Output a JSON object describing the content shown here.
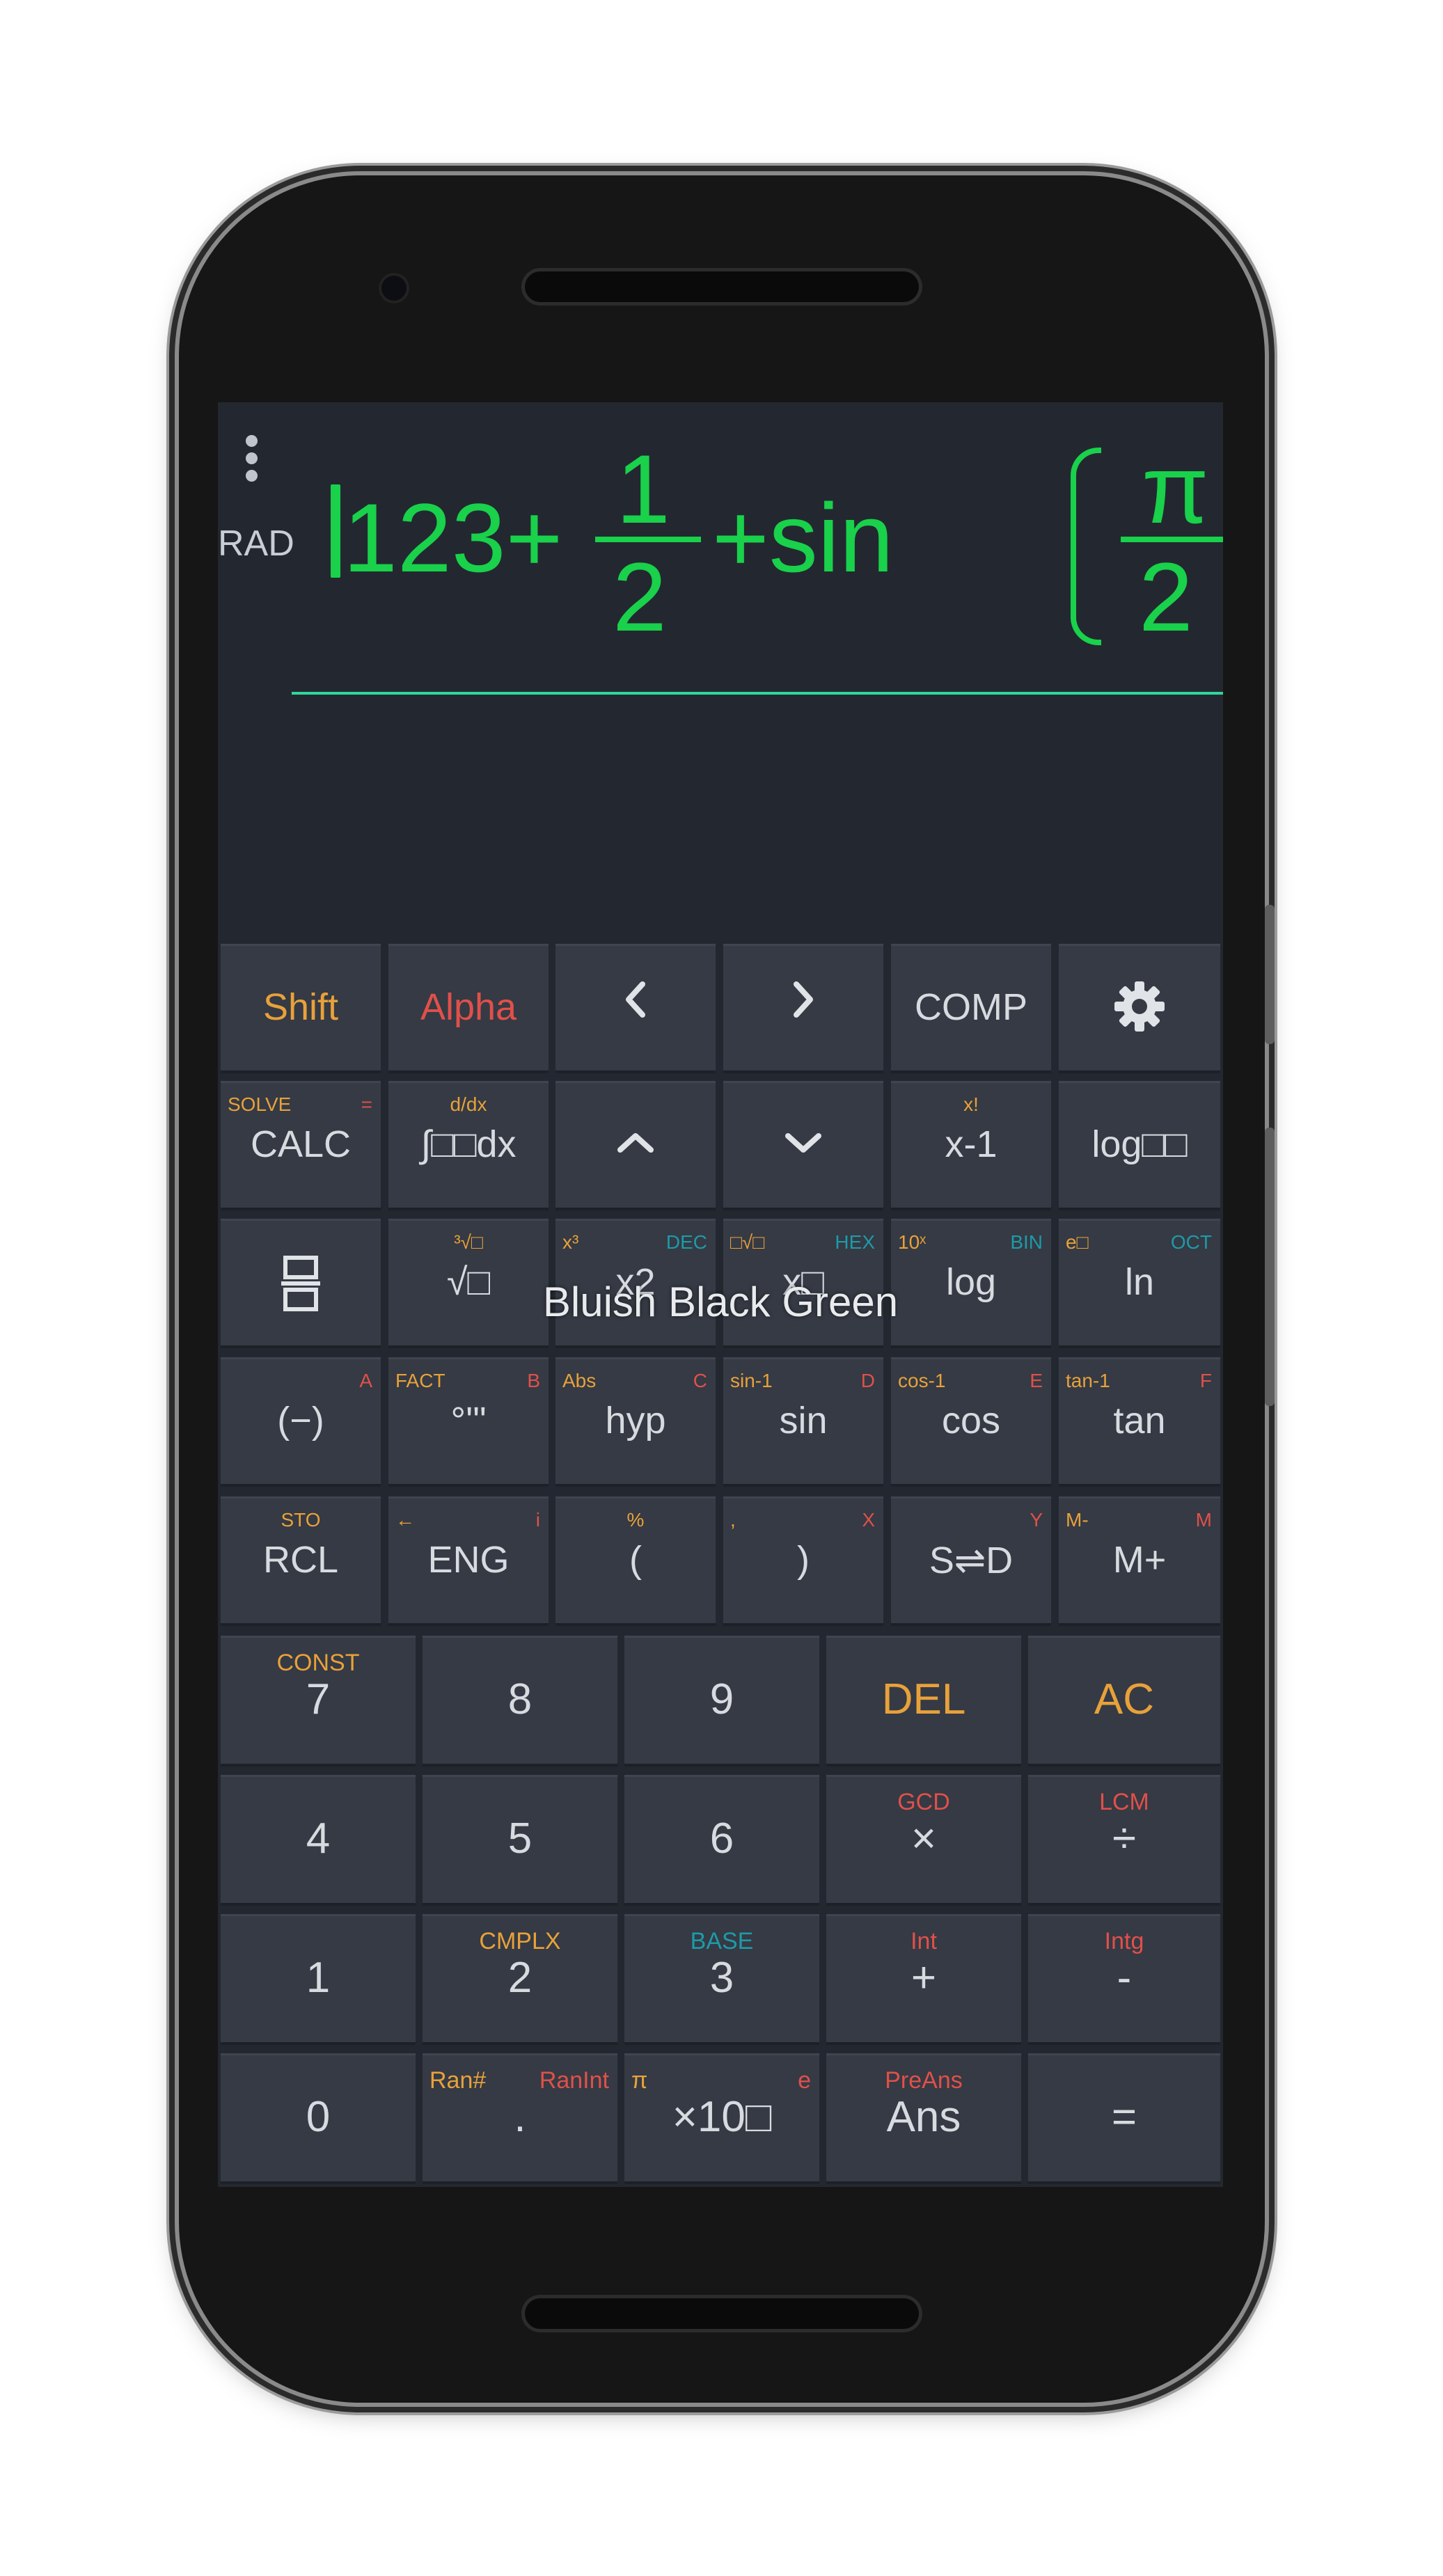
{
  "display": {
    "angle_mode": "RAD",
    "expression": {
      "lead": "123+",
      "frac1_num": "1",
      "frac1_den": "2",
      "func": "+sin",
      "frac2_num": "π",
      "frac2_den": "2"
    }
  },
  "theme_name": "Bluish Black Green",
  "colors": {
    "expression": "#19d14a",
    "shift": "#e8a13a",
    "alpha": "#e0504a",
    "hex": "#1e9aa8",
    "screen": "#232830",
    "key": "#353a44"
  },
  "keys": {
    "shift": "Shift",
    "alpha": "Alpha",
    "left": "<",
    "right": ">",
    "comp": "COMP",
    "settings_icon": "gear-icon",
    "calc": {
      "main": "CALC",
      "shift": "SOLVE",
      "alpha": "="
    },
    "integral": {
      "main": "∫□□dx",
      "shift": "d/dx"
    },
    "up": "^",
    "down": "v",
    "inverse": {
      "main": "x-1",
      "shift": "x!"
    },
    "logbase": {
      "main": "log□□"
    },
    "fraction_icon": "fraction-icon",
    "sqrt": {
      "main": "√□",
      "shift": "³√□"
    },
    "square": {
      "main": "x2",
      "shift": "x³",
      "alpha": "DEC"
    },
    "power": {
      "main": "x□",
      "shift": "□√□",
      "alpha": "HEX"
    },
    "log": {
      "main": "log",
      "shift": "10ˣ",
      "alpha": "BIN"
    },
    "ln": {
      "main": "ln",
      "shift": "e□",
      "alpha": "OCT"
    },
    "negate": {
      "main": "(−)",
      "alpha": "A"
    },
    "dms": {
      "main": "°'\"",
      "shift": "FACT",
      "alpha": "B"
    },
    "hyp": {
      "main": "hyp",
      "shift": "Abs",
      "alpha": "C"
    },
    "sin": {
      "main": "sin",
      "shift": "sin-1",
      "alpha": "D"
    },
    "cos": {
      "main": "cos",
      "shift": "cos-1",
      "alpha": "E"
    },
    "tan": {
      "main": "tan",
      "shift": "tan-1",
      "alpha": "F"
    },
    "rcl": {
      "main": "RCL",
      "shift": "STO"
    },
    "eng": {
      "main": "ENG",
      "shift": "←",
      "alpha": "i"
    },
    "lparen": {
      "main": "(",
      "shift": "%"
    },
    "rparen": {
      "main": ")",
      "shift": ",",
      "alpha": "X"
    },
    "sd": {
      "main": "S⇌D",
      "alpha": "Y"
    },
    "mplus": {
      "main": "M+",
      "shift": "M-",
      "alpha": "M"
    },
    "seven": {
      "main": "7",
      "shift": "CONST"
    },
    "eight": "8",
    "nine": "9",
    "del": "DEL",
    "ac": "AC",
    "four": "4",
    "five": "5",
    "six": "6",
    "times": {
      "main": "×",
      "alpha": "GCD"
    },
    "divide": {
      "main": "÷",
      "alpha": "LCM"
    },
    "one": "1",
    "two": {
      "main": "2",
      "shift": "CMPLX"
    },
    "three": {
      "main": "3",
      "hex": "BASE"
    },
    "plus": {
      "main": "+",
      "alpha": "Int"
    },
    "minus": {
      "main": "-",
      "alpha": "Intg"
    },
    "zero": "0",
    "dot": {
      "main": ".",
      "shift": "Ran#",
      "alpha": "RanInt"
    },
    "exp10": {
      "main": "×10□",
      "shift": "π",
      "alpha": "e"
    },
    "ans": {
      "main": "Ans",
      "alpha": "PreAns"
    },
    "equals": "="
  }
}
